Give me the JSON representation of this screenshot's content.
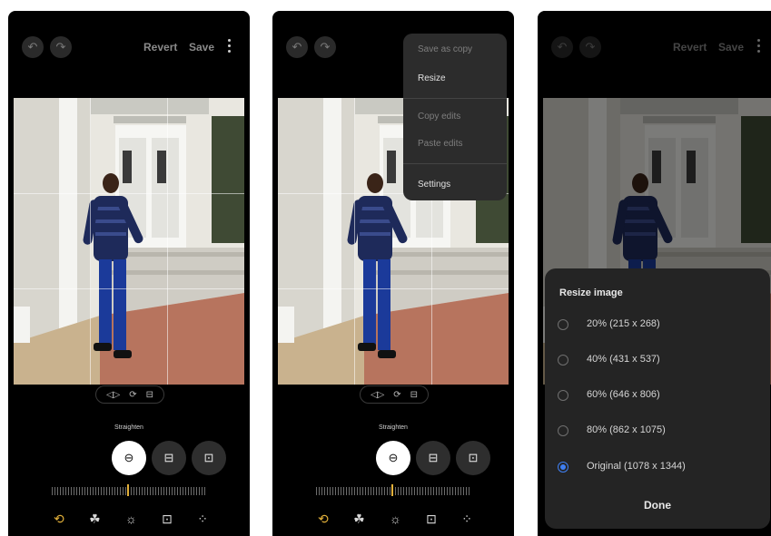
{
  "toolbar": {
    "undo_icon": "undo-icon",
    "redo_icon": "redo-icon",
    "revert_label": "Revert",
    "save_label": "Save",
    "more_icon": "more-vertical-icon"
  },
  "adjust_pill": {
    "icons": [
      "flip-horizontal-icon",
      "rotate-icon",
      "straighten-icon"
    ],
    "glyphs": [
      "◁▷",
      "⟳",
      "⊟"
    ]
  },
  "mode": {
    "label": "Straighten",
    "buttons": [
      {
        "name": "straighten-mode-icon",
        "glyph": "⊖",
        "selected": true
      },
      {
        "name": "vertical-perspective-icon",
        "glyph": "⊟",
        "selected": false
      },
      {
        "name": "horizontal-perspective-icon",
        "glyph": "⊡",
        "selected": false
      }
    ]
  },
  "bottom_tools": [
    {
      "name": "transform-icon",
      "glyph": "⟲"
    },
    {
      "name": "filters-icon",
      "glyph": "☘"
    },
    {
      "name": "adjust-icon",
      "glyph": "☼"
    },
    {
      "name": "decorate-icon",
      "glyph": "⊡"
    },
    {
      "name": "more-tools-icon",
      "glyph": "⁘"
    }
  ],
  "overflow_menu": {
    "items": [
      {
        "label": "Save as copy",
        "enabled": false
      },
      {
        "label": "Resize",
        "enabled": true
      },
      {
        "label": "Copy edits",
        "enabled": false
      },
      {
        "label": "Paste edits",
        "enabled": false
      },
      {
        "label": "Settings",
        "enabled": true
      }
    ]
  },
  "resize_sheet": {
    "title": "Resize image",
    "options": [
      {
        "label": "20% (215 x 268)",
        "selected": false
      },
      {
        "label": "40% (431 x 537)",
        "selected": false
      },
      {
        "label": "60% (646 x 806)",
        "selected": false
      },
      {
        "label": "80% (862 x 1075)",
        "selected": false
      },
      {
        "label": "Original (1078 x 1344)",
        "selected": true
      }
    ],
    "done_label": "Done"
  },
  "colors": {
    "accent": "#e3b13a",
    "radio_selected": "#3f7ff2",
    "menu_bg": "#2c2c2c",
    "sheet_bg": "#242424"
  }
}
